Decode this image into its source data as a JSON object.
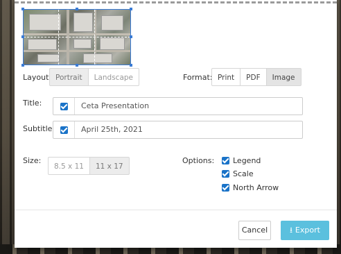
{
  "layout": {
    "label": "Layout:",
    "options": [
      "Portrait",
      "Landscape"
    ]
  },
  "format": {
    "label": "Format:",
    "options": [
      "Print",
      "PDF",
      "Image"
    ],
    "selected": "Image"
  },
  "title": {
    "label": "Title:",
    "value": "Ceta Presentation",
    "checked": true
  },
  "subtitle": {
    "label": "Subtitle:",
    "value": "April 25th, 2021",
    "checked": true
  },
  "size": {
    "label": "Size:",
    "options": [
      "8.5 x 11",
      "11 x 17"
    ],
    "selected": "11 x 17"
  },
  "options": {
    "label": "Options:",
    "items": [
      {
        "label": "Legend",
        "checked": true
      },
      {
        "label": "Scale",
        "checked": true
      },
      {
        "label": "North Arrow",
        "checked": true
      }
    ]
  },
  "footer": {
    "cancel_label": "Cancel",
    "export_label": "Export",
    "export_icon": "export-icon"
  },
  "colors": {
    "accent": "#1a73c8",
    "export_button": "#5bc0de"
  }
}
